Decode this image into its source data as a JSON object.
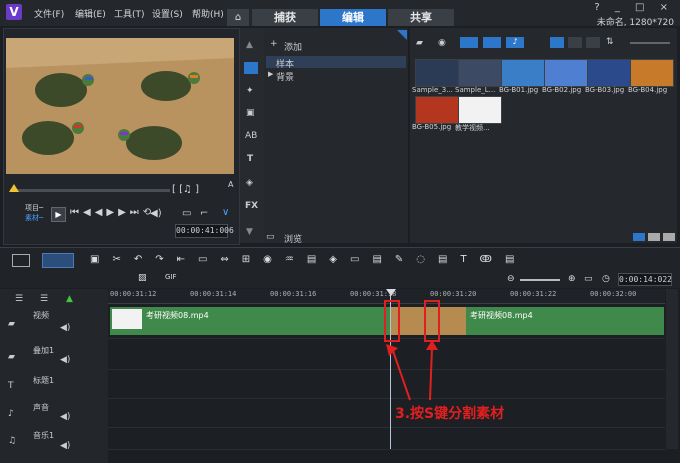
{
  "app": {
    "logo_letter": "V"
  },
  "menu": [
    {
      "label": "文件(F)"
    },
    {
      "label": "编辑(E)"
    },
    {
      "label": "工具(T)"
    },
    {
      "label": "设置(S)"
    },
    {
      "label": "帮助(H)"
    }
  ],
  "tabs": [
    {
      "label": "捕获",
      "active": false
    },
    {
      "label": "编辑",
      "active": true
    },
    {
      "label": "共享",
      "active": false
    }
  ],
  "window_controls": "? _ □ ×",
  "project_info": "未命名, 1280*720",
  "preview": {
    "labels": {
      "project": "项目─",
      "clip": "素材─"
    },
    "bracket_buttons": "[ [♫ ]",
    "timecode": "00:00:41:006",
    "zoom": "A"
  },
  "library": {
    "add_label": "添加",
    "tree": [
      {
        "label": "样本",
        "selected": true
      },
      {
        "label": "背景",
        "selected": false
      }
    ],
    "browse_label": "浏览",
    "thumbnails": [
      {
        "label": "Sample_3...",
        "color": "#2b3b55"
      },
      {
        "label": "Sample_L...",
        "color": "#3c4a63"
      },
      {
        "label": "BG-B01.jpg",
        "color": "#3b7ec8"
      },
      {
        "label": "BG-B02.jpg",
        "color": "#4f7fd0"
      },
      {
        "label": "BG-B03.jpg",
        "color": "#2b4a8c"
      },
      {
        "label": "BG-B04.jpg",
        "color": "#c77a2a"
      },
      {
        "label": "BG-B05.jpg",
        "color": "#b5361e"
      },
      {
        "label": "教学视频...",
        "color": "#f2f2f2"
      }
    ]
  },
  "timeline": {
    "timecode": "0:00:14:022",
    "ruler": [
      "00:00:31:12",
      "00:00:31:14",
      "00:00:31:16",
      "00:00:31:18",
      "00:00:31:20",
      "00:00:31:22",
      "00:00:32:00"
    ],
    "tracks": [
      {
        "name": "视频"
      },
      {
        "name": "叠加1"
      },
      {
        "name": "标题1"
      },
      {
        "name": "声音"
      },
      {
        "name": "音乐1"
      }
    ],
    "clips": [
      {
        "label": "考研视频08.mp4"
      },
      {
        "label": "考研视频08.mp4"
      }
    ]
  },
  "annotation": "3.按S键分割素材",
  "colors": {
    "accent": "#2c77c9",
    "clip": "#3f8a4a",
    "annotation": "#e02020",
    "playhead_marker": "#f2c230"
  }
}
